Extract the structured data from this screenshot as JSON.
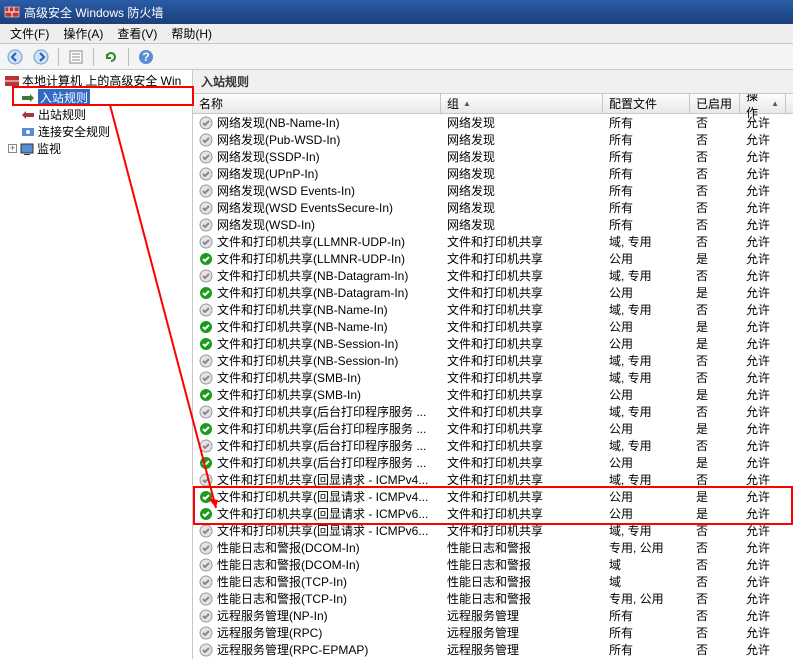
{
  "window_title": "高级安全 Windows 防火墙",
  "menu": [
    "文件(F)",
    "操作(A)",
    "查看(V)",
    "帮助(H)"
  ],
  "tree": {
    "root": "本地计算机 上的高级安全 Win",
    "items": [
      "入站规则",
      "出站规则",
      "连接安全规则",
      "监视"
    ],
    "selected_index": 0
  },
  "pane_title": "入站规则",
  "columns": {
    "name": "名称",
    "group": "组",
    "profile": "配置文件",
    "enabled": "已启用",
    "action": "操作"
  },
  "rules": [
    {
      "en": false,
      "name": "网络发现(NB-Name-In)",
      "group": "网络发现",
      "profile": "所有",
      "enabled": "否",
      "action": "允许"
    },
    {
      "en": false,
      "name": "网络发现(Pub-WSD-In)",
      "group": "网络发现",
      "profile": "所有",
      "enabled": "否",
      "action": "允许"
    },
    {
      "en": false,
      "name": "网络发现(SSDP-In)",
      "group": "网络发现",
      "profile": "所有",
      "enabled": "否",
      "action": "允许"
    },
    {
      "en": false,
      "name": "网络发现(UPnP-In)",
      "group": "网络发现",
      "profile": "所有",
      "enabled": "否",
      "action": "允许"
    },
    {
      "en": false,
      "name": "网络发现(WSD Events-In)",
      "group": "网络发现",
      "profile": "所有",
      "enabled": "否",
      "action": "允许"
    },
    {
      "en": false,
      "name": "网络发现(WSD EventsSecure-In)",
      "group": "网络发现",
      "profile": "所有",
      "enabled": "否",
      "action": "允许"
    },
    {
      "en": false,
      "name": "网络发现(WSD-In)",
      "group": "网络发现",
      "profile": "所有",
      "enabled": "否",
      "action": "允许"
    },
    {
      "en": false,
      "name": "文件和打印机共享(LLMNR-UDP-In)",
      "group": "文件和打印机共享",
      "profile": "域, 专用",
      "enabled": "否",
      "action": "允许"
    },
    {
      "en": true,
      "name": "文件和打印机共享(LLMNR-UDP-In)",
      "group": "文件和打印机共享",
      "profile": "公用",
      "enabled": "是",
      "action": "允许"
    },
    {
      "en": false,
      "name": "文件和打印机共享(NB-Datagram-In)",
      "group": "文件和打印机共享",
      "profile": "域, 专用",
      "enabled": "否",
      "action": "允许"
    },
    {
      "en": true,
      "name": "文件和打印机共享(NB-Datagram-In)",
      "group": "文件和打印机共享",
      "profile": "公用",
      "enabled": "是",
      "action": "允许"
    },
    {
      "en": false,
      "name": "文件和打印机共享(NB-Name-In)",
      "group": "文件和打印机共享",
      "profile": "域, 专用",
      "enabled": "否",
      "action": "允许"
    },
    {
      "en": true,
      "name": "文件和打印机共享(NB-Name-In)",
      "group": "文件和打印机共享",
      "profile": "公用",
      "enabled": "是",
      "action": "允许"
    },
    {
      "en": true,
      "name": "文件和打印机共享(NB-Session-In)",
      "group": "文件和打印机共享",
      "profile": "公用",
      "enabled": "是",
      "action": "允许"
    },
    {
      "en": false,
      "name": "文件和打印机共享(NB-Session-In)",
      "group": "文件和打印机共享",
      "profile": "域, 专用",
      "enabled": "否",
      "action": "允许"
    },
    {
      "en": false,
      "name": "文件和打印机共享(SMB-In)",
      "group": "文件和打印机共享",
      "profile": "域, 专用",
      "enabled": "否",
      "action": "允许"
    },
    {
      "en": true,
      "name": "文件和打印机共享(SMB-In)",
      "group": "文件和打印机共享",
      "profile": "公用",
      "enabled": "是",
      "action": "允许"
    },
    {
      "en": false,
      "name": "文件和打印机共享(后台打印程序服务 ...",
      "group": "文件和打印机共享",
      "profile": "域, 专用",
      "enabled": "否",
      "action": "允许"
    },
    {
      "en": true,
      "name": "文件和打印机共享(后台打印程序服务 ...",
      "group": "文件和打印机共享",
      "profile": "公用",
      "enabled": "是",
      "action": "允许"
    },
    {
      "en": false,
      "name": "文件和打印机共享(后台打印程序服务 ...",
      "group": "文件和打印机共享",
      "profile": "域, 专用",
      "enabled": "否",
      "action": "允许"
    },
    {
      "en": true,
      "name": "文件和打印机共享(后台打印程序服务 ...",
      "group": "文件和打印机共享",
      "profile": "公用",
      "enabled": "是",
      "action": "允许"
    },
    {
      "en": false,
      "name": "文件和打印机共享(回显请求 - ICMPv4...",
      "group": "文件和打印机共享",
      "profile": "域, 专用",
      "enabled": "否",
      "action": "允许"
    },
    {
      "en": true,
      "name": "文件和打印机共享(回显请求 - ICMPv4...",
      "group": "文件和打印机共享",
      "profile": "公用",
      "enabled": "是",
      "action": "允许"
    },
    {
      "en": true,
      "name": "文件和打印机共享(回显请求 - ICMPv6...",
      "group": "文件和打印机共享",
      "profile": "公用",
      "enabled": "是",
      "action": "允许"
    },
    {
      "en": false,
      "name": "文件和打印机共享(回显请求 - ICMPv6...",
      "group": "文件和打印机共享",
      "profile": "域, 专用",
      "enabled": "否",
      "action": "允许"
    },
    {
      "en": false,
      "name": "性能日志和警报(DCOM-In)",
      "group": "性能日志和警报",
      "profile": "专用, 公用",
      "enabled": "否",
      "action": "允许"
    },
    {
      "en": false,
      "name": "性能日志和警报(DCOM-In)",
      "group": "性能日志和警报",
      "profile": "域",
      "enabled": "否",
      "action": "允许"
    },
    {
      "en": false,
      "name": "性能日志和警报(TCP-In)",
      "group": "性能日志和警报",
      "profile": "域",
      "enabled": "否",
      "action": "允许"
    },
    {
      "en": false,
      "name": "性能日志和警报(TCP-In)",
      "group": "性能日志和警报",
      "profile": "专用, 公用",
      "enabled": "否",
      "action": "允许"
    },
    {
      "en": false,
      "name": "远程服务管理(NP-In)",
      "group": "远程服务管理",
      "profile": "所有",
      "enabled": "否",
      "action": "允许"
    },
    {
      "en": false,
      "name": "远程服务管理(RPC)",
      "group": "远程服务管理",
      "profile": "所有",
      "enabled": "否",
      "action": "允许"
    },
    {
      "en": false,
      "name": "远程服务管理(RPC-EPMAP)",
      "group": "远程服务管理",
      "profile": "所有",
      "enabled": "否",
      "action": "允许"
    }
  ]
}
